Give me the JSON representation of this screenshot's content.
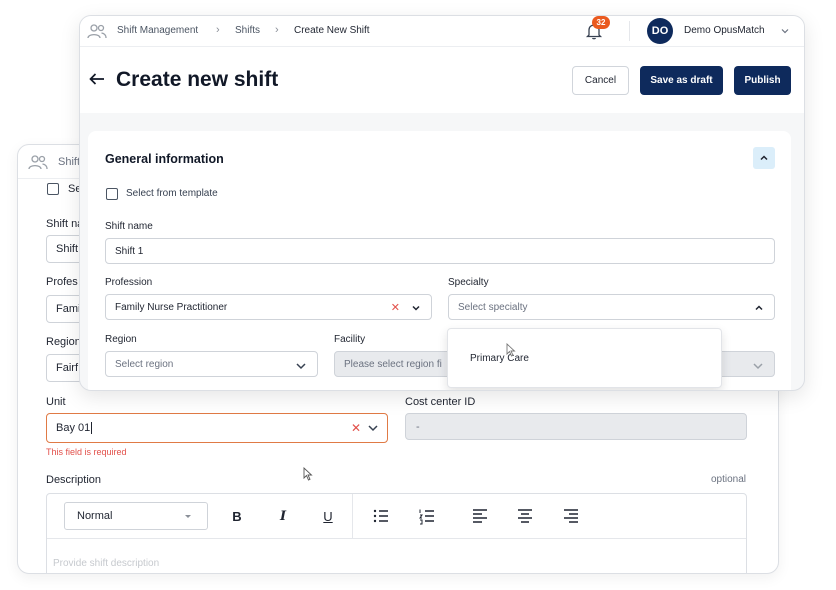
{
  "back_window": {
    "breadcrumb_partial": "Shift",
    "checkbox_label_partial": "Se",
    "shift_name_label": "Shift na",
    "shift_name_value": "Shift",
    "profession_label": "Profes",
    "profession_value": "Fami",
    "region_label": "Region",
    "region_value": "Fairf",
    "unit_label": "Unit",
    "unit_value": "Bay 01",
    "unit_error": "This field is required",
    "cost_center_label": "Cost center ID",
    "cost_center_value": "-",
    "description_label": "Description",
    "description_optional": "optional",
    "editor": {
      "format_value": "Normal",
      "bold": "B",
      "italic": "I",
      "underline": "U",
      "placeholder": "Provide shift description"
    }
  },
  "front_window": {
    "breadcrumb": [
      "Shift Management",
      "Shifts",
      "Create New Shift"
    ],
    "notification_count": "32",
    "avatar_initials": "DO",
    "user_name": "Demo OpusMatch",
    "page_title": "Create new shift",
    "buttons": {
      "cancel": "Cancel",
      "save_draft": "Save as draft",
      "publish": "Publish"
    },
    "section_title": "General information",
    "select_template_label": "Select from template",
    "shift_name_label": "Shift name",
    "shift_name_value": "Shift 1",
    "profession_label": "Profession",
    "profession_value": "Family Nurse Practitioner",
    "specialty_label": "Specialty",
    "specialty_placeholder": "Select specialty",
    "specialty_options": [
      "Primary Care"
    ],
    "region_label": "Region",
    "region_placeholder": "Select region",
    "facility_label": "Facility",
    "facility_placeholder": "Please select region fi"
  },
  "colors": {
    "primary_navy": "#0e2a5c",
    "badge_orange": "#ea5a1f",
    "error_red": "#e2504a",
    "error_border": "#e07a45",
    "collapse_bg": "#dbeefa"
  }
}
